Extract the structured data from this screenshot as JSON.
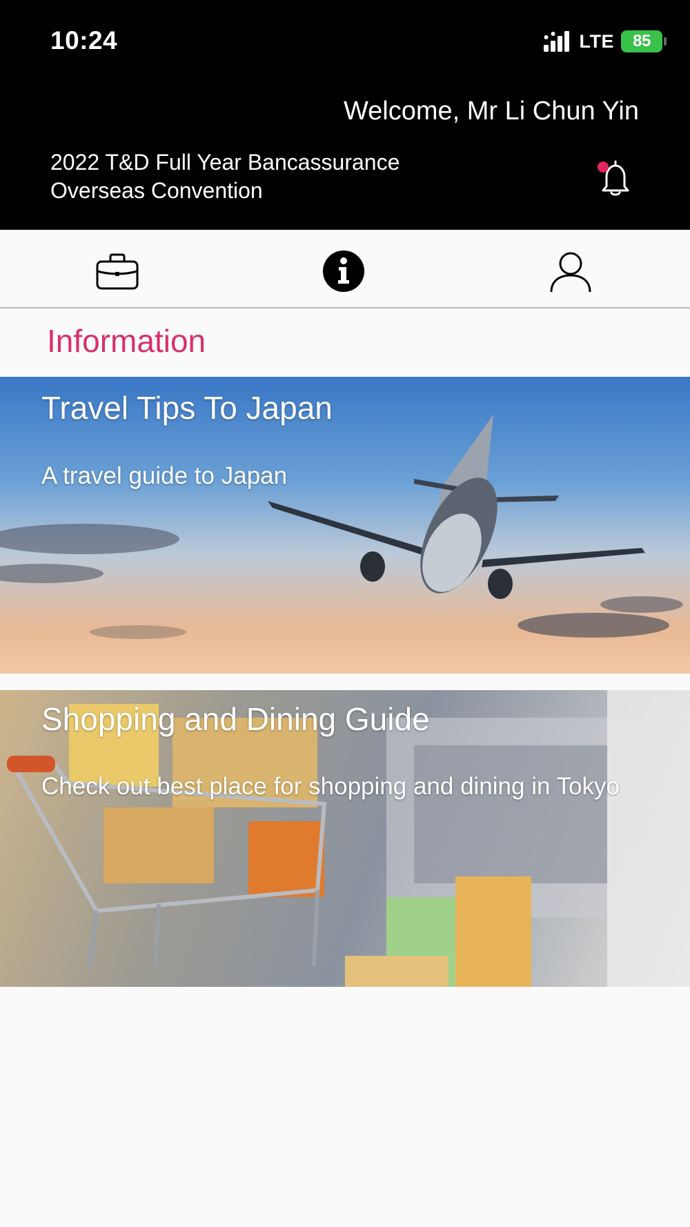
{
  "status_bar": {
    "time": "10:24",
    "network": "LTE",
    "battery": "85",
    "icons": [
      "signal-icon",
      "battery-charging-icon"
    ]
  },
  "header": {
    "welcome": "Welcome, Mr Li Chun Yin",
    "event_title": "2022 T&D Full Year Bancassurance Overseas Convention",
    "notification_icon": "bell-icon",
    "has_unread": true
  },
  "tabs": [
    {
      "icon": "briefcase-icon",
      "selected": false
    },
    {
      "icon": "info-icon",
      "selected": true
    },
    {
      "icon": "person-icon",
      "selected": false
    }
  ],
  "section": {
    "title": "Information"
  },
  "cards": [
    {
      "title": "Travel Tips To Japan",
      "description": "A travel guide to Japan",
      "image": "airplane-sky"
    },
    {
      "title": "Shopping and Dining Guide",
      "description": "Check out best place for shopping and dining in Tokyo",
      "image": "shopping-cart-bags"
    }
  ],
  "colors": {
    "header_bg": "#000000",
    "accent": "#d8306b",
    "battery": "#39c14a",
    "page_bg": "#fafafa"
  }
}
